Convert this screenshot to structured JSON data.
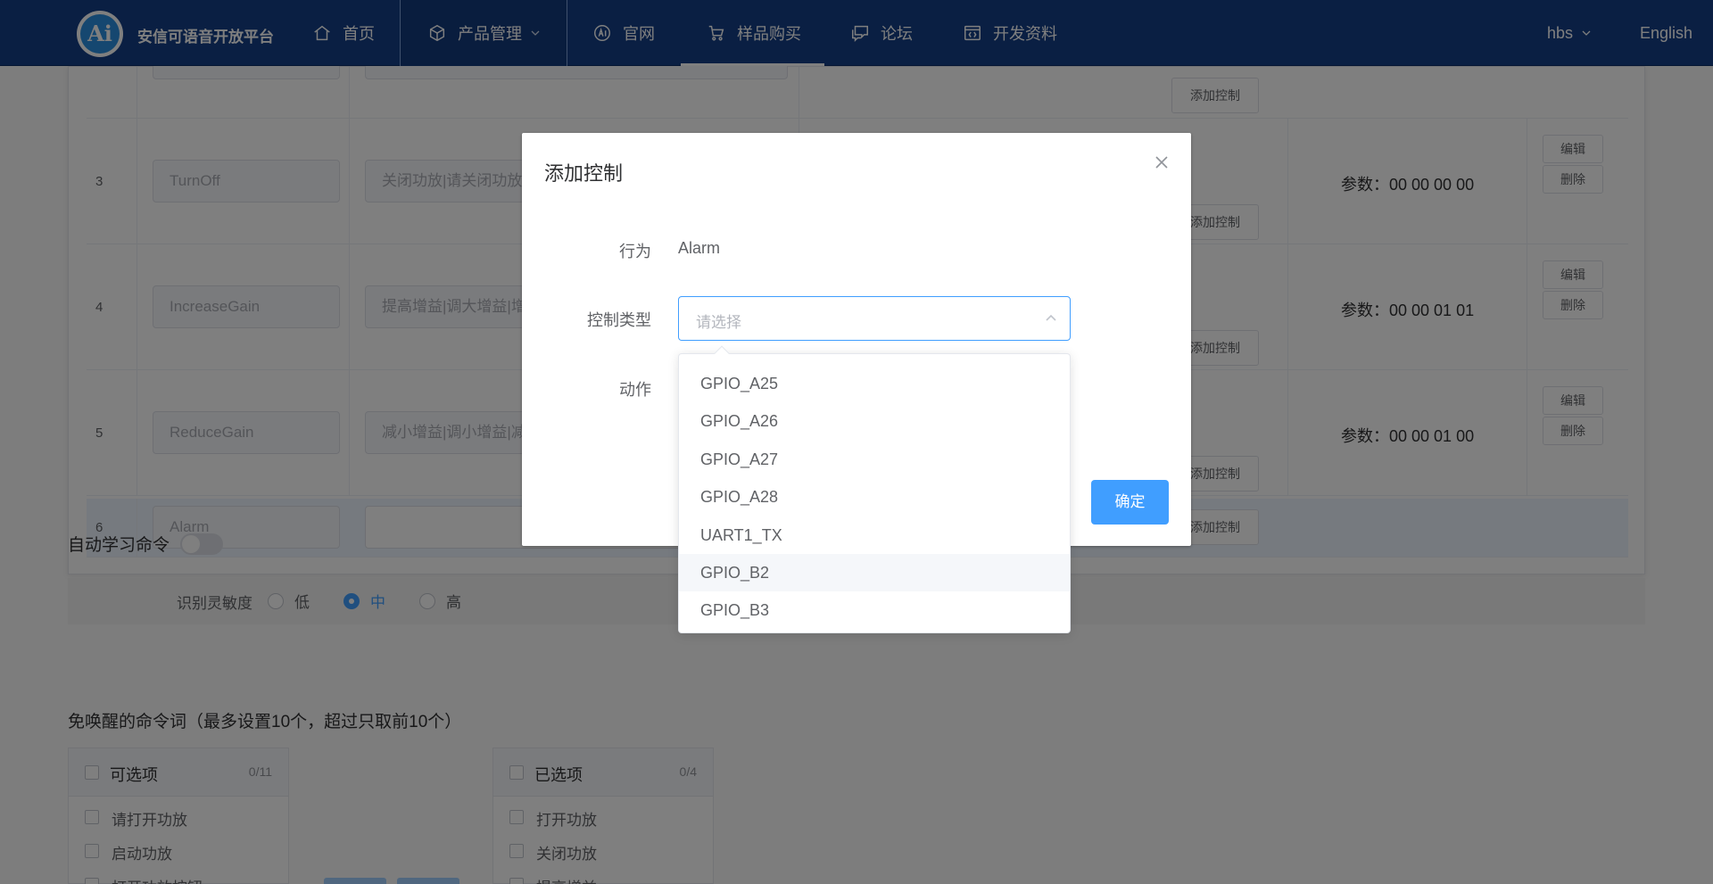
{
  "nav": {
    "brand": "安信可语音开放平台",
    "logo_text": "Ai",
    "items": [
      {
        "label": "首页",
        "icon": "home-icon"
      },
      {
        "label": "产品管理",
        "icon": "cube-icon"
      },
      {
        "label": "官网",
        "icon": "ai-icon"
      },
      {
        "label": "样品购买",
        "icon": "cart-icon"
      },
      {
        "label": "论坛",
        "icon": "chat-icon"
      },
      {
        "label": "开发资料",
        "icon": "code-doc-icon"
      }
    ],
    "user": "hbs",
    "language": "English"
  },
  "table": {
    "rows": [
      {
        "index": "3",
        "name": "TurnOff",
        "phrases": "关闭功放|请关闭功放",
        "param": "参数：00 00 00 00",
        "edit": "编辑",
        "delete": "删除",
        "add": "添加控制"
      },
      {
        "index": "4",
        "name": "IncreaseGain",
        "phrases": "提高增益|调大增益|增",
        "param": "参数：00 00 01 01",
        "edit": "编辑",
        "delete": "删除",
        "add": "添加控制"
      },
      {
        "index": "5",
        "name": "ReduceGain",
        "phrases": "减小增益|调小增益|减",
        "param": "参数：00 00 01 00",
        "edit": "编辑",
        "delete": "删除",
        "add": "添加控制"
      },
      {
        "index": "6",
        "name": "Alarm",
        "phrases": "",
        "add": "添加控制"
      }
    ],
    "top_add": "添加控制"
  },
  "auto_learn": {
    "label": "自动学习命令",
    "enabled": false
  },
  "sensitivity": {
    "label": "识别灵敏度",
    "options": [
      "低",
      "中",
      "高"
    ],
    "selected": "中"
  },
  "wake_free": {
    "title": "免唤醒的命令词（最多设置10个，超过只取前10个）",
    "available": {
      "title": "可选项",
      "count": "0/11",
      "items": [
        "请打开功放",
        "启动功放",
        "打开功放按钮"
      ]
    },
    "selected": {
      "title": "已选项",
      "count": "0/4",
      "items": [
        "打开功放",
        "关闭功放",
        "提高增益"
      ]
    }
  },
  "dialog": {
    "title": "添加控制",
    "behavior_label": "行为",
    "behavior_value": "Alarm",
    "control_type_label": "控制类型",
    "control_type_placeholder": "请选择",
    "action_label": "动作",
    "ok_label": "确定"
  },
  "dropdown": {
    "options": [
      "GPIO_A25",
      "GPIO_A26",
      "GPIO_A27",
      "GPIO_A28",
      "UART1_TX",
      "GPIO_B2",
      "GPIO_B3"
    ],
    "hovered": "GPIO_B2"
  },
  "colors": {
    "nav_bg": "#143e86",
    "primary": "#409eff"
  }
}
